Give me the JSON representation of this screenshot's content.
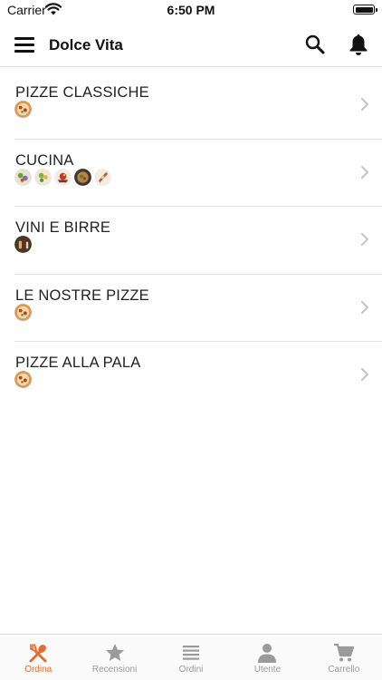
{
  "status_bar": {
    "carrier": "Carrier",
    "time": "6:50 PM"
  },
  "header": {
    "title": "Dolce Vita"
  },
  "categories": [
    {
      "name": "PIZZE CLASSICHE",
      "thumbnails": [
        "pizza"
      ]
    },
    {
      "name": "CUCINA",
      "thumbnails": [
        "salad",
        "salad",
        "dessert",
        "plate",
        "wrap"
      ]
    },
    {
      "name": "VINI E BIRRE",
      "thumbnails": [
        "drinks"
      ]
    },
    {
      "name": "LE NOSTRE PIZZE",
      "thumbnails": [
        "pizza"
      ]
    },
    {
      "name": "PIZZE ALLA PALA",
      "thumbnails": [
        "pizza"
      ]
    }
  ],
  "tabs": [
    {
      "label": "Ordina",
      "icon": "fork-knife-icon",
      "active": true
    },
    {
      "label": "Recensioni",
      "icon": "star-icon",
      "active": false
    },
    {
      "label": "Ordini",
      "icon": "list-icon",
      "active": false
    },
    {
      "label": "Utente",
      "icon": "user-icon",
      "active": false
    },
    {
      "label": "Carrello",
      "icon": "cart-icon",
      "active": false
    }
  ],
  "colors": {
    "accent": "#e46c2f",
    "inactive": "#9a9a9a",
    "divider": "#e3e3e3"
  }
}
